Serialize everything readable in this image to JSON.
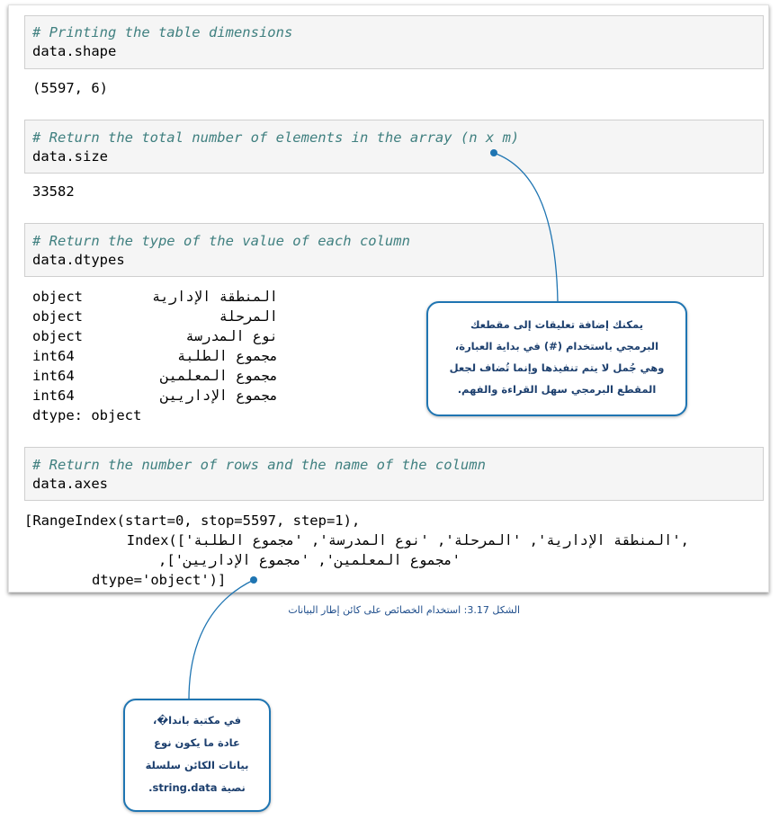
{
  "cells": [
    {
      "comment": "# Printing the table dimensions",
      "code": "data.shape",
      "output": [
        "(5597, 6)"
      ]
    },
    {
      "comment": "# Return the total number of elements in the array (n x m)",
      "code": "data.size",
      "output": [
        "33582"
      ]
    },
    {
      "comment": "# Return the type of the value of each column",
      "code": "data.dtypes"
    },
    {
      "comment": "# Return the number of rows and the name of the column",
      "code": "data.axes"
    }
  ],
  "dtypes_rows": [
    {
      "type": "object",
      "name": "المنطقة الإدارية"
    },
    {
      "type": "object",
      "name": "المرحلة"
    },
    {
      "type": "object",
      "name": "نوع المدرسة"
    },
    {
      "type": "int64",
      "name": "مجموع الطلبة"
    },
    {
      "type": "int64",
      "name": "مجموع المعلمين"
    },
    {
      "type": "int64",
      "name": "مجموع الإداريين"
    }
  ],
  "dtypes_footer": "dtype: object",
  "axes_output": {
    "line1": "[RangeIndex(start=0, stop=5597, step=1),",
    "line2": "Index(['المنطقة الإدارية', 'المرحلة', 'نوع المدرسة', 'مجموع الطلبة',",
    "line3": "'مجموع المعلمين', 'مجموع الإداريين'],",
    "line4": "dtype='object')]"
  },
  "callout_comments": {
    "lines": [
      "يمكنك إضافة تعليقات إلى مقطعك",
      "البرمجي باستخدام (#) في بداية العبارة،",
      "وهي جُمل لا يتم تنفيذها وإنما تُضاف لجعل",
      "المقطع البرمجي سهل القراءة والفهم."
    ]
  },
  "callout_pandas": {
    "lines": [
      "في مكتبة باندا�،",
      "عادة ما يكون نوع",
      "بيانات الكائن سلسلة",
      "نصية string.data."
    ]
  },
  "caption": "الشكل 3.17: استخدام الخصائص على كائن إطار البيانات",
  "colors": {
    "comment": "#408080",
    "callout_border": "#1f75b2",
    "callout_text": "#1c3f6e",
    "caption": "#1f4e8c"
  }
}
